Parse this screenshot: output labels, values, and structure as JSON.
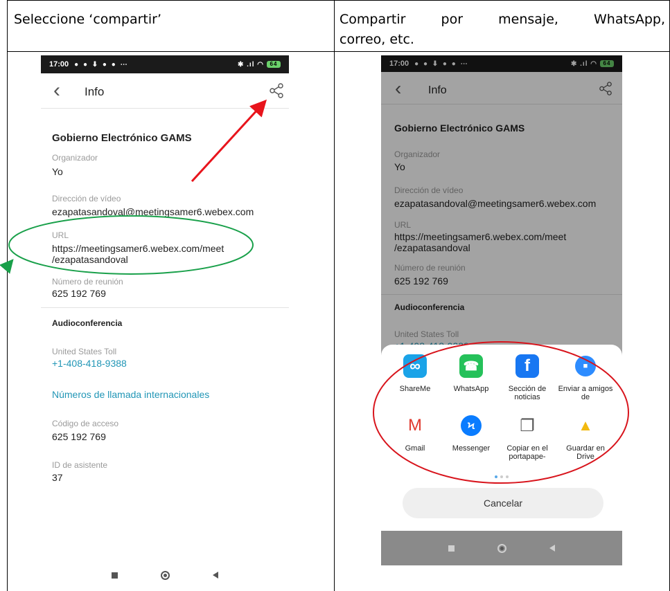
{
  "header": {
    "left": "Seleccione ‘compartir’",
    "right_line1": "Compartir por mensaje, WhatsApp,",
    "right_line2": "correo, etc."
  },
  "status": {
    "time": "17:00",
    "icons": "● ● ⬇ ● ● ⋯",
    "right": "✱ .ıl ◠",
    "battery": "64"
  },
  "screen": {
    "back": "‹",
    "title": "Info",
    "meeting_name": "Gobierno Electrónico GAMS",
    "organizer_label": "Organizador",
    "organizer": "Yo",
    "video_label": "Dirección de vídeo",
    "video": "ezapatasandoval@meetingsamer6.webex.com",
    "url_label": "URL",
    "url_line1": "https://meetingsamer6.webex.com/meet",
    "url_line2": "/ezapatasandoval",
    "number_label": "Número de reunión",
    "number": "625 192 769",
    "audio_heading": "Audioconferencia",
    "toll_label": "United States Toll",
    "toll": "+1-408-418-9388",
    "intl": "Números de llamada internacionales",
    "access_label": "Código de acceso",
    "access": "625 192 769",
    "attendee_label": "ID de asistente",
    "attendee": "37"
  },
  "share": {
    "partial_toll_label": "United States Toll",
    "partial_toll": "+1-408-418-9388",
    "apps": [
      {
        "name": "ShareMe",
        "icon": "shareme-icon",
        "color": "#1aa3e8",
        "glyph": "∞"
      },
      {
        "name": "WhatsApp",
        "icon": "whatsapp-icon",
        "color": "#25c15a",
        "glyph": "☎"
      },
      {
        "name": "Sección de noticias",
        "icon": "facebook-icon",
        "color": "#1877f2",
        "glyph": "f"
      },
      {
        "name": "Enviar a amigos de",
        "icon": "zoom-icon",
        "color": "#2d8cff",
        "glyph": "■"
      },
      {
        "name": "Gmail",
        "icon": "gmail-icon",
        "color": "#ffffff",
        "glyph": "M"
      },
      {
        "name": "Messenger",
        "icon": "messenger-icon",
        "color": "#0a7cff",
        "glyph": "Ϟ"
      },
      {
        "name": "Copiar en el portapape-",
        "icon": "copy-icon",
        "color": "#ffffff",
        "glyph": "❐"
      },
      {
        "name": "Guardar en Drive",
        "icon": "drive-icon",
        "color": "#ffffff",
        "glyph": "▲"
      }
    ],
    "cancel": "Cancelar"
  },
  "colors": {
    "arrow_red": "#e8141c",
    "ellipse_green": "#19a04a",
    "ellipse_red": "#d8141c",
    "link_blue": "#2196b6"
  }
}
